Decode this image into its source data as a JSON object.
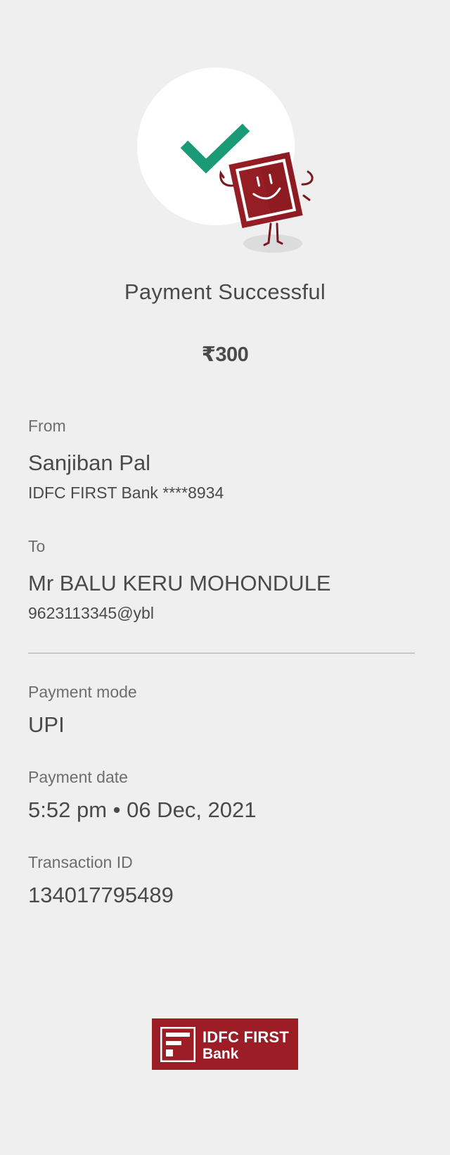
{
  "header": {
    "status_title": "Payment Successful",
    "amount": "₹300"
  },
  "from": {
    "label": "From",
    "name": "Sanjiban Pal",
    "account": "IDFC FIRST Bank ****8934"
  },
  "to": {
    "label": "To",
    "name": "Mr BALU KERU MOHONDULE",
    "vpa": "9623113345@ybl"
  },
  "details": {
    "mode_label": "Payment mode",
    "mode_value": "UPI",
    "date_label": "Payment date",
    "date_value": "5:52 pm • 06 Dec, 2021",
    "txn_label": "Transaction ID",
    "txn_value": "134017795489"
  },
  "footer": {
    "logo_line1": "IDFC FIRST",
    "logo_line2": "Bank"
  },
  "colors": {
    "background": "#efefef",
    "check": "#1a9a76",
    "brand": "#9c1d26",
    "text": "#4a4a4a",
    "label": "#6e6e6e"
  },
  "icons": {
    "success": "check-icon",
    "mascot": "mascot-icon",
    "logo": "idfc-logo-icon"
  }
}
